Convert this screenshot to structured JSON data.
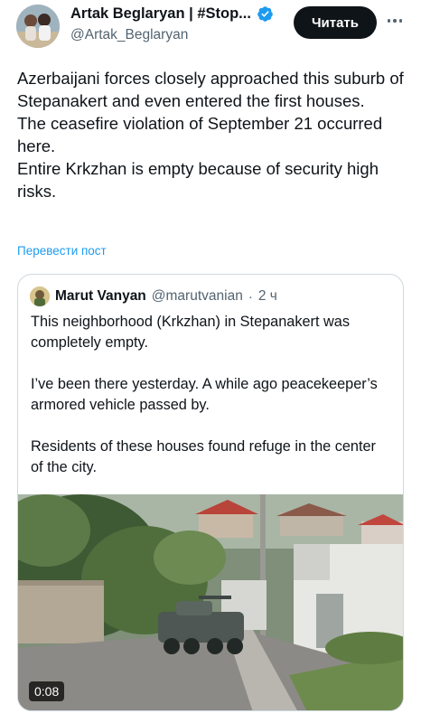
{
  "author": {
    "display_name": "Artak Beglaryan | #Stop...",
    "handle": "@Artak_Beglaryan",
    "verified": true
  },
  "follow_button_label": "Читать",
  "more_icon": "more-horizontal-icon",
  "tweet": {
    "paragraphs": [
      "Azerbaijani forces closely approached this suburb of Stepanakert and even entered the first houses.",
      "The ceasefire violation of September 21 occurred here.",
      "Entire Krkzhan is empty because of security high risks."
    ],
    "translate_label": "Перевести пост"
  },
  "quote": {
    "display_name": "Marut Vanyan",
    "handle": "@marutvanian",
    "separator": "·",
    "time": "2 ч",
    "paragraphs": [
      "This neighborhood (Krkzhan) in Stepanakert was completely empty.",
      "I’ve been there yesterday. A while ago peacekeeper’s armored vehicle passed by.",
      "Residents of these houses found refuge in the center of the city."
    ],
    "video_duration": "0:08"
  },
  "colors": {
    "accent_blue": "#1d9bf0",
    "text_primary": "#0f1419",
    "text_secondary": "#536471",
    "border": "#cfd9de",
    "button_dark": "#0f1419"
  }
}
